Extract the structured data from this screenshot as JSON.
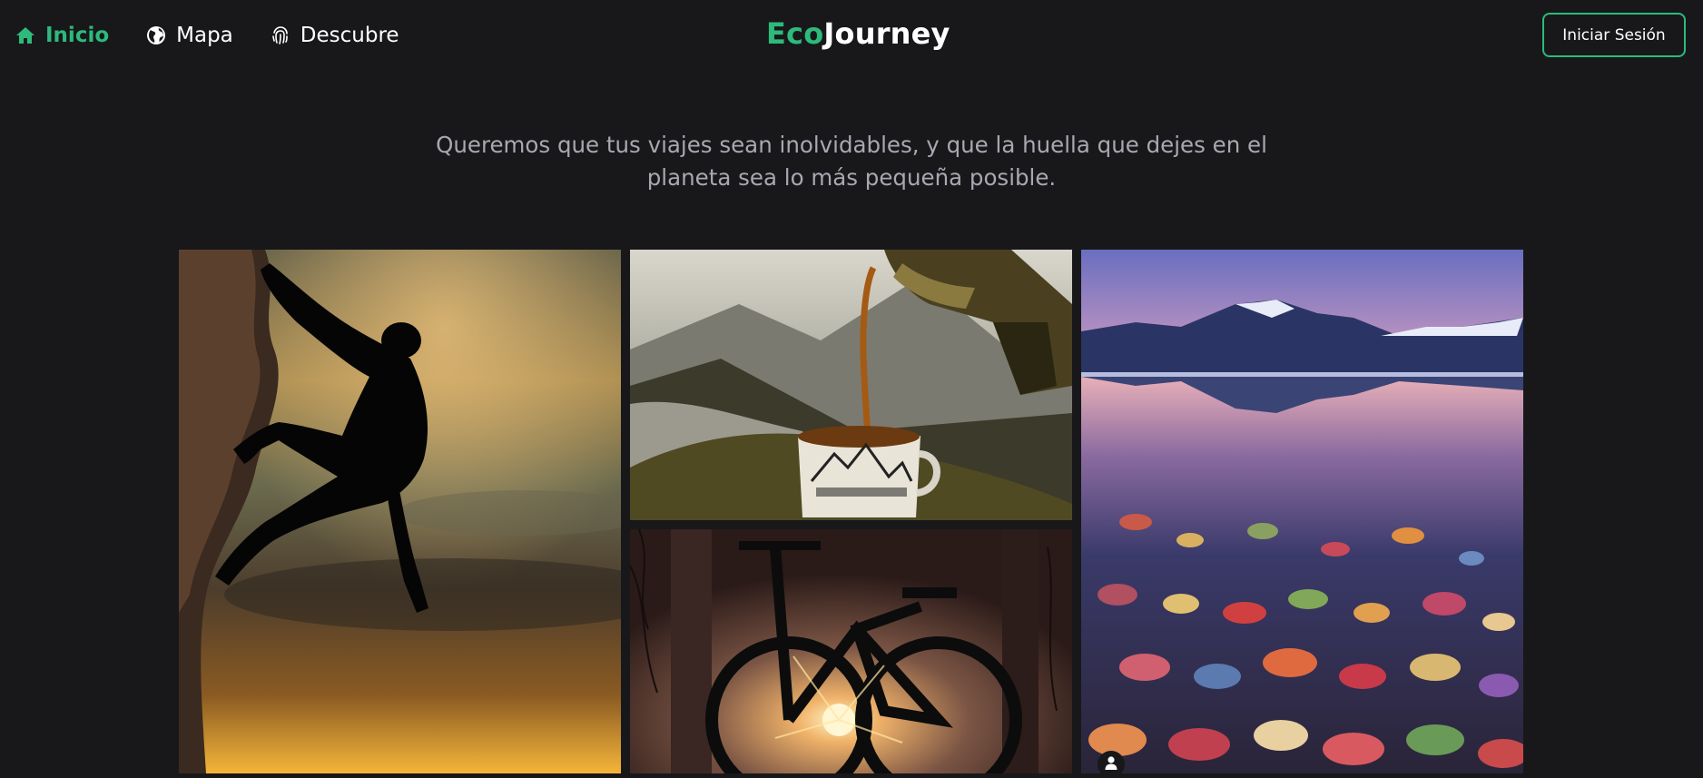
{
  "nav": {
    "items": [
      {
        "label": "Inicio",
        "icon": "home-icon",
        "active": true
      },
      {
        "label": "Mapa",
        "icon": "globe-icon",
        "active": false
      },
      {
        "label": "Descubre",
        "icon": "fingerprint-icon",
        "active": false
      }
    ]
  },
  "brand": {
    "part1": "Eco",
    "part2": "Journey"
  },
  "auth": {
    "login_label": "Iniciar Sesión"
  },
  "hero": {
    "tagline": "Queremos que tus viajes sean inolvidables, y que la huella que dejes en el planeta sea lo más pequeña posible."
  },
  "colors": {
    "accent": "#2dba7b",
    "background": "#18181b",
    "muted_text": "#a8a8b0"
  },
  "gallery": [
    {
      "subject": "rock climber silhouette at sunset"
    },
    {
      "subject": "coffee poured into enamel mug in mountains"
    },
    {
      "subject": "bicycle silhouette at sunset"
    },
    {
      "subject": "mountain lake with colorful pebbles"
    }
  ]
}
